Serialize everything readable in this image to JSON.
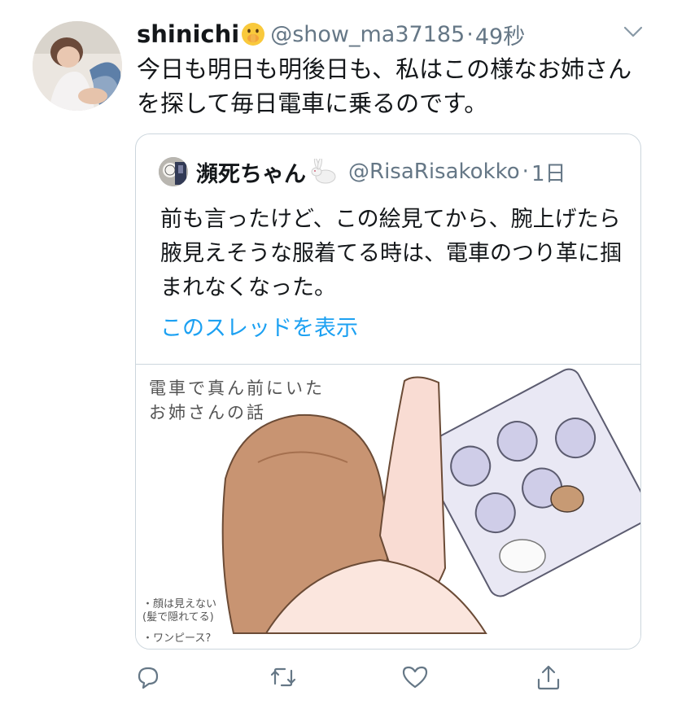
{
  "tweet": {
    "display_name": "shinichi",
    "handle": "@show_ma37185",
    "separator": "·",
    "time": "49秒",
    "text": "今日も明日も明後日も、私はこの様なお姉さんを探して毎日電車に乗るのです。",
    "emoji": "shushing-face-emoji"
  },
  "quoted_tweet": {
    "display_name": "瀕死ちゃん",
    "emoji": "rabbit-emoji",
    "handle": "@RisaRisakokko",
    "separator": "·",
    "time": "1日",
    "text": "前も言ったけど、この絵見てから、腕上げたら腋見えそうな服着てる時は、電車のつり革に掴まれなくなった。",
    "thread_link": "このスレッドを表示",
    "image": {
      "title_lines": [
        "電車で真ん前にいた",
        "お姉さんの話"
      ],
      "notes": [
        "・顔は見えない",
        "(髪で隠れてる)",
        "・ワンピース?"
      ]
    }
  },
  "actions": [
    "reply-icon",
    "retweet-icon",
    "like-icon",
    "share-icon"
  ],
  "colors": {
    "text": "#14171a",
    "secondary": "#657786",
    "link": "#1da1f2",
    "border": "#ccd6dd"
  }
}
